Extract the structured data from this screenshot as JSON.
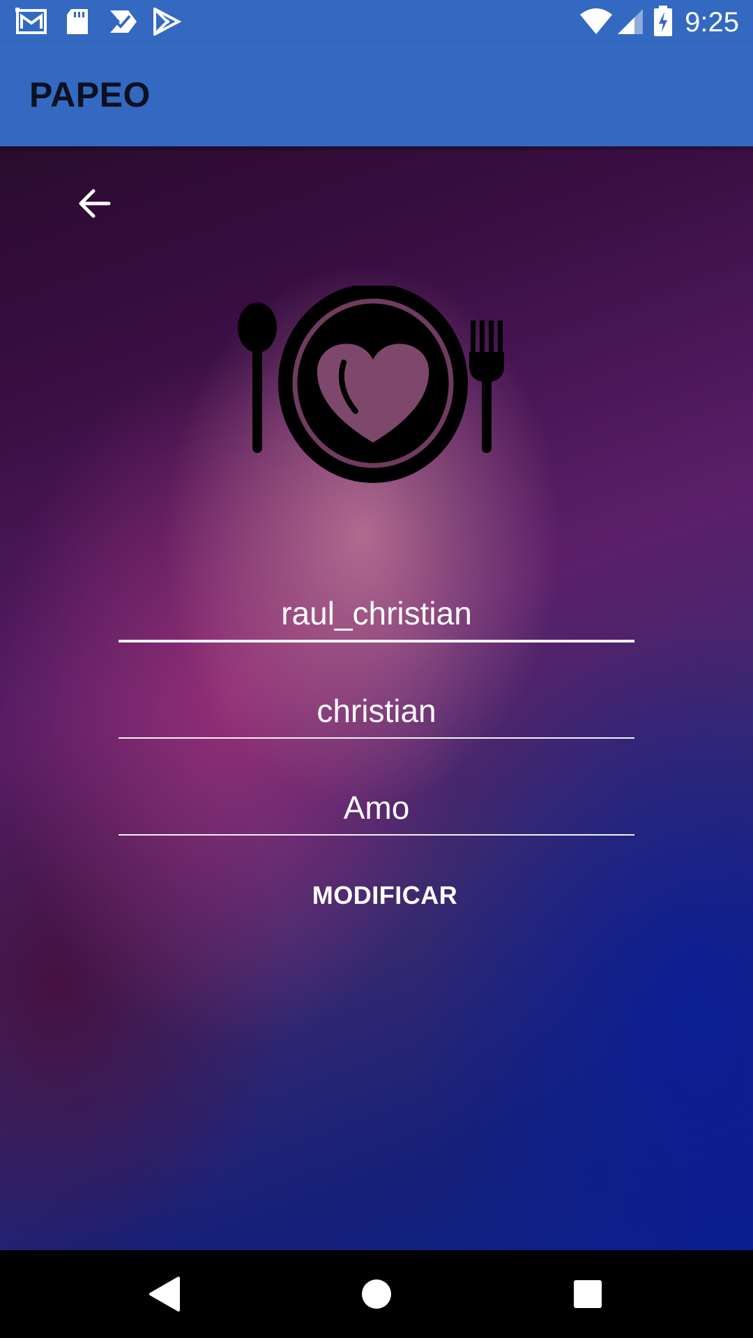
{
  "status_bar": {
    "time": "9:25",
    "icons": [
      "gmail-icon",
      "sd-card-icon",
      "task-check-icon",
      "play-store-icon",
      "wifi-icon",
      "signal-icon",
      "battery-charging-icon"
    ]
  },
  "app_bar": {
    "title": "PAPEO"
  },
  "content": {
    "back_icon": "arrow-back-icon",
    "logo_icon": "plate-heart-cutlery-icon",
    "fields": [
      {
        "value": "raul_christian",
        "focused": true
      },
      {
        "value": "christian",
        "focused": false
      },
      {
        "value": "Amo",
        "focused": false
      }
    ],
    "modify_button_label": "MODIFICAR"
  },
  "nav_bar": {
    "buttons": [
      "back-triangle-icon",
      "home-circle-icon",
      "recents-square-icon"
    ]
  },
  "colors": {
    "primary": "#3369c0",
    "title_text": "#0d1020",
    "field_text": "#ffffff",
    "underline": "#f2f2f2"
  }
}
